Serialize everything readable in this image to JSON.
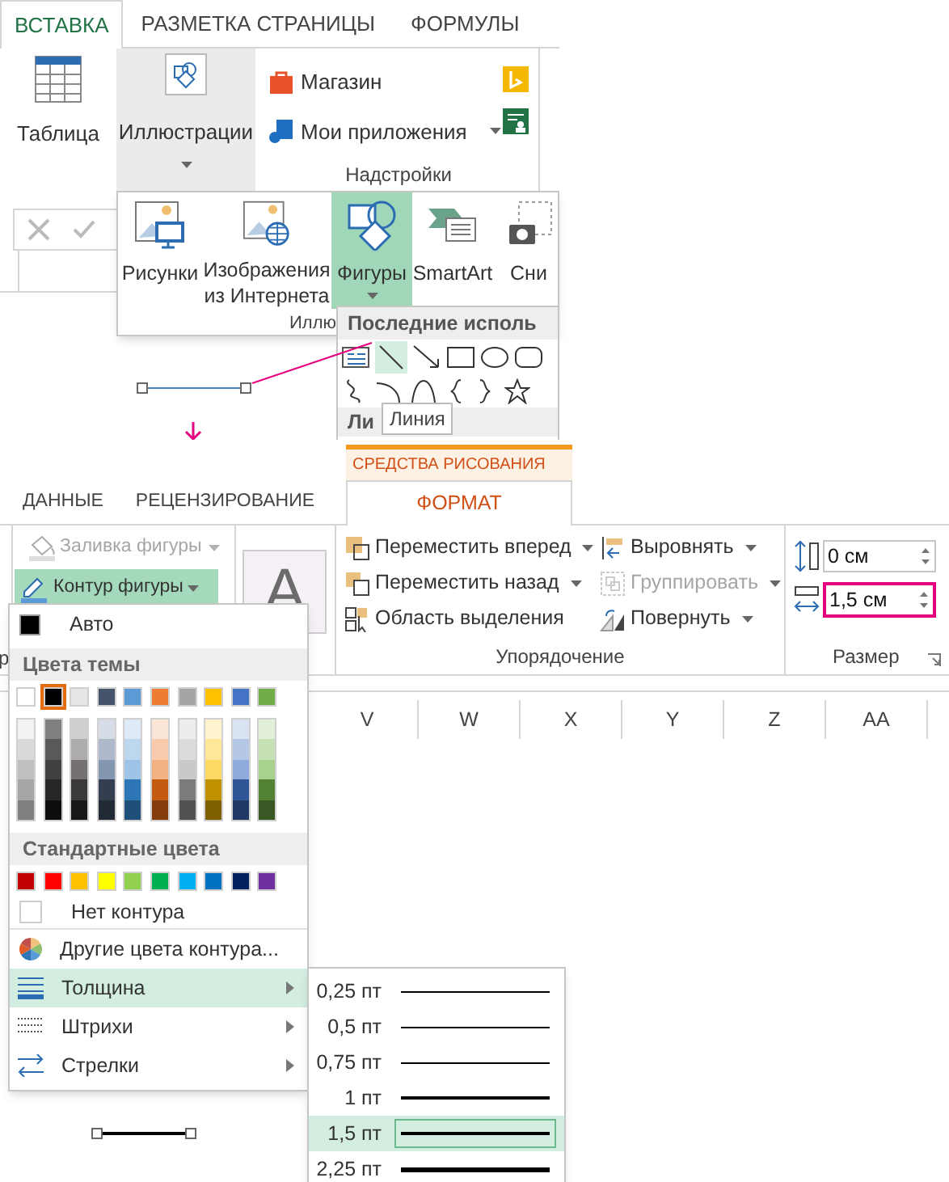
{
  "insert_ribbon": {
    "tabs": [
      {
        "label": "ВСТАВКА",
        "selected": true
      },
      {
        "label": "РАЗМЕТКА СТРАНИЦЫ",
        "selected": false
      },
      {
        "label": "ФОРМУЛЫ",
        "selected": false
      }
    ],
    "table_button": "Таблица",
    "illustrations_button": {
      "label": "Иллюстрации",
      "pressed": true
    },
    "addins": [
      "Магазин",
      "Мои приложения"
    ],
    "addins_label": "Надстройки"
  },
  "illustrations_panel": {
    "items": [
      {
        "label": "Рисунки",
        "selected": false
      },
      {
        "label": "Изображения из Интернета",
        "selected": false
      },
      {
        "label": "Фигуры",
        "selected": true
      },
      {
        "label": "SmartArt",
        "selected": false
      },
      {
        "label": "Сни",
        "selected": false
      }
    ],
    "group_label": "Иллю"
  },
  "shapes_menu": {
    "header": "Последние исполь",
    "line_highlighted": true,
    "section": "Ли",
    "tooltip": "Линия"
  },
  "drawing_tools": {
    "context_label": "СРЕДСТВА РИСОВАНИЯ",
    "tabs": [
      {
        "label": "ДАННЫЕ",
        "selected": false
      },
      {
        "label": "РЕЦЕНЗИРОВАНИЕ",
        "selected": false
      },
      {
        "label": "ФОРМАТ",
        "selected": true
      }
    ]
  },
  "format_ribbon": {
    "cut_label": "р",
    "fill": {
      "label": "Заливка фигуры",
      "disabled": true
    },
    "outline": {
      "label": "Контур фигуры",
      "pressed": true
    },
    "style_letter": "A",
    "arrange": [
      {
        "label": "Переместить вперед",
        "disabled": false,
        "dropdown": true
      },
      {
        "label": "Выровнять",
        "disabled": false,
        "dropdown": true
      },
      {
        "label": "Переместить назад",
        "disabled": false,
        "dropdown": true
      },
      {
        "label": "Группировать",
        "disabled": true,
        "dropdown": true
      },
      {
        "label": "Область выделения",
        "disabled": false,
        "dropdown": false
      },
      {
        "label": "Повернуть",
        "disabled": false,
        "dropdown": true
      }
    ],
    "arrange_label": "Упорядочение",
    "height_value": "0 см",
    "width_value": "1,5 см",
    "width_highlighted": true,
    "size_label": "Размер"
  },
  "columns": [
    "V",
    "W",
    "X",
    "Y",
    "Z",
    "AA"
  ],
  "outline_menu": {
    "auto": "Авто",
    "theme_header": "Цвета темы",
    "theme_colors": [
      {
        "color": "#ffffff",
        "selected": false,
        "shades": [
          {
            "color": "#f2f2f2"
          },
          {
            "color": "#d9d9d9"
          },
          {
            "color": "#bfbfbf"
          },
          {
            "color": "#a6a6a6"
          },
          {
            "color": "#808080"
          }
        ]
      },
      {
        "color": "#000000",
        "selected": true,
        "shades": [
          {
            "color": "#808080"
          },
          {
            "color": "#595959"
          },
          {
            "color": "#404040"
          },
          {
            "color": "#262626"
          },
          {
            "color": "#0d0d0d"
          }
        ]
      },
      {
        "color": "#e7e6e6",
        "selected": false,
        "shades": [
          {
            "color": "#d0cece"
          },
          {
            "color": "#aeabab"
          },
          {
            "color": "#757171"
          },
          {
            "color": "#3b3838"
          },
          {
            "color": "#181717"
          }
        ]
      },
      {
        "color": "#44546a",
        "selected": false,
        "shades": [
          {
            "color": "#d6dce5"
          },
          {
            "color": "#adb9ca"
          },
          {
            "color": "#8497b0"
          },
          {
            "color": "#333f50"
          },
          {
            "color": "#222a35"
          }
        ]
      },
      {
        "color": "#5b9bd5",
        "selected": false,
        "shades": [
          {
            "color": "#deebf7"
          },
          {
            "color": "#bdd7ee"
          },
          {
            "color": "#9dc3e6"
          },
          {
            "color": "#2e75b6"
          },
          {
            "color": "#1f4e79"
          }
        ]
      },
      {
        "color": "#ed7d31",
        "selected": false,
        "shades": [
          {
            "color": "#fbe5d6"
          },
          {
            "color": "#f8cbad"
          },
          {
            "color": "#f4b183"
          },
          {
            "color": "#c55a11"
          },
          {
            "color": "#843c0c"
          }
        ]
      },
      {
        "color": "#a5a5a5",
        "selected": false,
        "shades": [
          {
            "color": "#ededed"
          },
          {
            "color": "#dbdbdb"
          },
          {
            "color": "#c9c9c9"
          },
          {
            "color": "#7b7b7b"
          },
          {
            "color": "#525252"
          }
        ]
      },
      {
        "color": "#ffc000",
        "selected": false,
        "shades": [
          {
            "color": "#fff2cc"
          },
          {
            "color": "#ffe699"
          },
          {
            "color": "#ffd966"
          },
          {
            "color": "#bf9000"
          },
          {
            "color": "#7f6000"
          }
        ]
      },
      {
        "color": "#4472c4",
        "selected": false,
        "shades": [
          {
            "color": "#dae3f3"
          },
          {
            "color": "#b4c7e7"
          },
          {
            "color": "#8faadc"
          },
          {
            "color": "#2f5597"
          },
          {
            "color": "#203864"
          }
        ]
      },
      {
        "color": "#70ad47",
        "selected": false,
        "shades": [
          {
            "color": "#e2f0d9"
          },
          {
            "color": "#c5e0b4"
          },
          {
            "color": "#a9d18e"
          },
          {
            "color": "#548235"
          },
          {
            "color": "#385723"
          }
        ]
      }
    ],
    "standard_header": "Стандартные цвета",
    "standard_colors": [
      {
        "color": "#c00000"
      },
      {
        "color": "#ff0000"
      },
      {
        "color": "#ffc000"
      },
      {
        "color": "#ffff00"
      },
      {
        "color": "#92d050"
      },
      {
        "color": "#00b050"
      },
      {
        "color": "#00b0f0"
      },
      {
        "color": "#0070c0"
      },
      {
        "color": "#002060"
      },
      {
        "color": "#7030a0"
      }
    ],
    "no_outline": "Нет контура",
    "more_colors": "Другие цвета контура...",
    "items": [
      {
        "label": "Толщина",
        "selected": true,
        "kind": "weight"
      },
      {
        "label": "Штрихи",
        "selected": false,
        "kind": "dashes"
      },
      {
        "label": "Стрелки",
        "selected": false,
        "kind": "arrows"
      }
    ]
  },
  "weight_menu": {
    "items": [
      {
        "label": "0,25 пт",
        "selected": false
      },
      {
        "label": "0,5 пт",
        "selected": false
      },
      {
        "label": "0,75 пт",
        "selected": false
      },
      {
        "label": "1 пт",
        "selected": false
      },
      {
        "label": "1,5 пт",
        "selected": true
      },
      {
        "label": "2,25 пт",
        "selected": false
      }
    ]
  }
}
